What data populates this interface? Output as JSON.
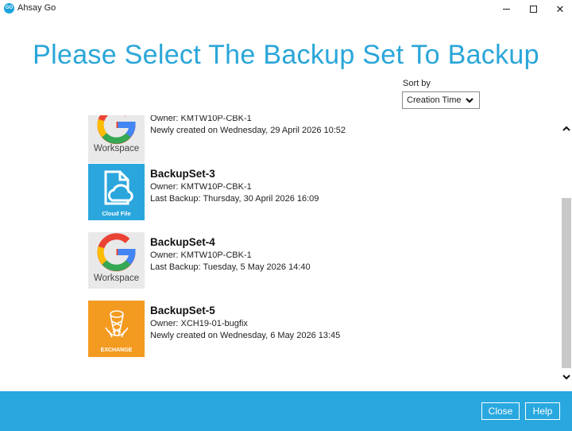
{
  "window": {
    "title": "Ahsay Go",
    "logo_text": "GO",
    "close_glyph": "✕"
  },
  "heading": "Please Select The Backup Set To Backup",
  "sort": {
    "label": "Sort by",
    "value": "Creation Time"
  },
  "backup_sets": [
    {
      "name": "",
      "icon": "google-workspace-icon",
      "icon_label": "Workspace",
      "owner": "Owner: KMTW10P-CBK-1",
      "status": "Newly created on Wednesday, 29 April 2026 10:52"
    },
    {
      "name": "BackupSet-3",
      "icon": "cloud-file-icon",
      "icon_label": "Cloud File",
      "owner": "Owner: KMTW10P-CBK-1",
      "status": "Last Backup: Thursday, 30 April 2026 16:09"
    },
    {
      "name": "BackupSet-4",
      "icon": "google-workspace-icon",
      "icon_label": "Workspace",
      "owner": "Owner: KMTW10P-CBK-1",
      "status": "Last Backup: Tuesday, 5 May 2026 14:40"
    },
    {
      "name": "BackupSet-5",
      "icon": "exchange-icon",
      "icon_label": "EXCHANGE",
      "owner": "Owner: XCH19-01-bugfix",
      "status": "Newly created on Wednesday, 6 May 2026 13:45"
    }
  ],
  "footer": {
    "close_label": "Close",
    "help_label": "Help"
  },
  "colors": {
    "accent": "#29a8e0",
    "title": "#2aa6d9",
    "cloud_tile": "#2ba6dd",
    "exchange_tile": "#f39a20"
  }
}
